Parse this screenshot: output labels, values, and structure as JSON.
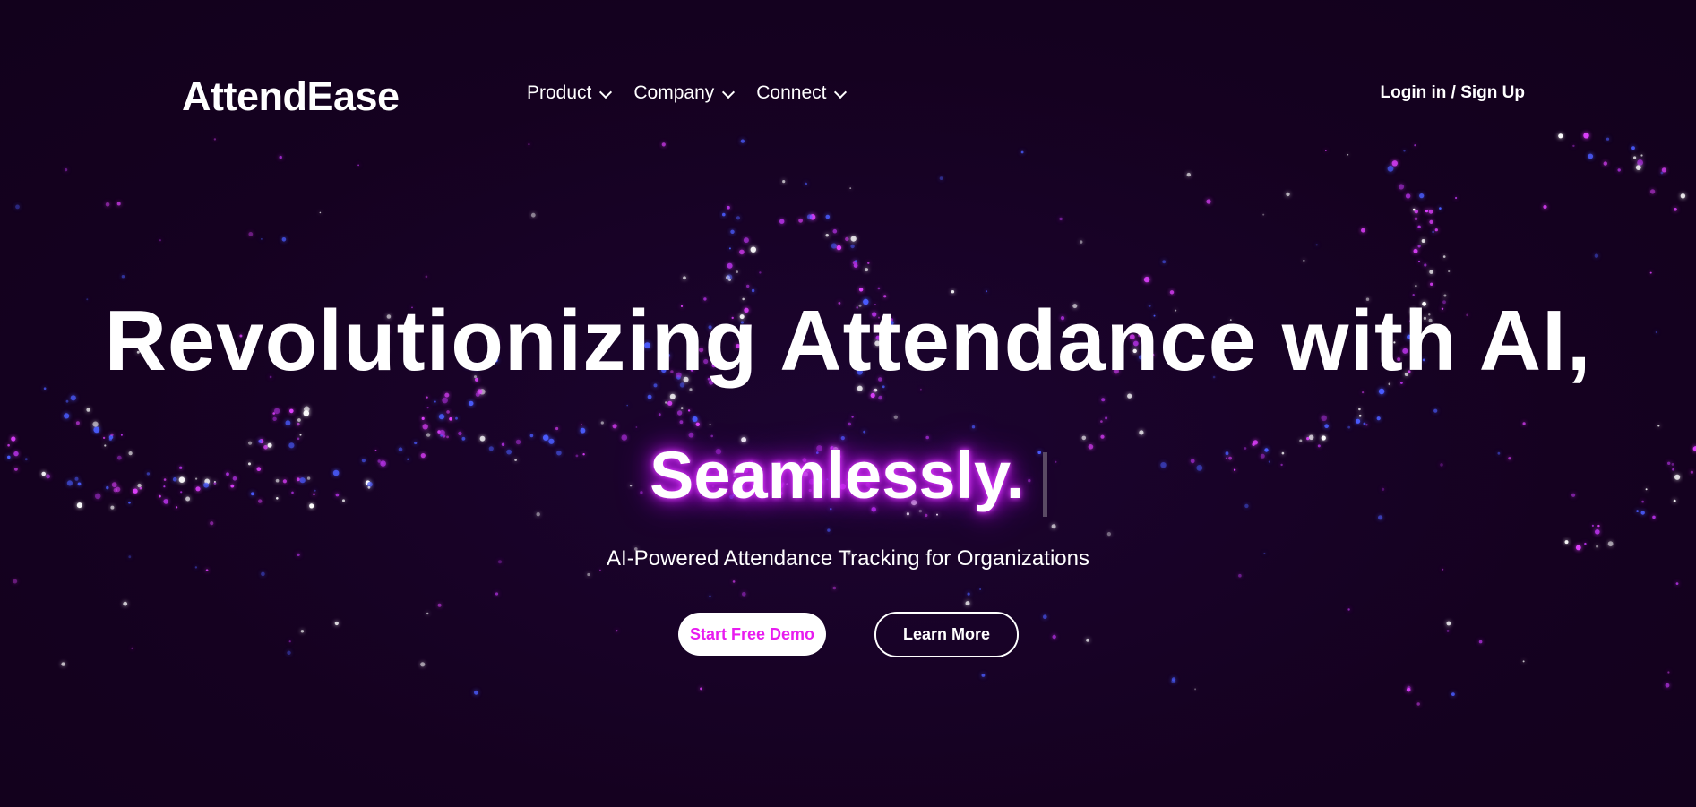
{
  "nav": {
    "brand": "AttendEase",
    "items": [
      {
        "label": "Product"
      },
      {
        "label": "Company"
      },
      {
        "label": "Connect"
      }
    ],
    "login_label": "Login in / Sign Up"
  },
  "hero": {
    "title": "Revolutionizing Attendance with AI,",
    "typed_word": "Seamlessly.",
    "subtitle": "AI-Powered Attendance Tracking for Organizations",
    "primary_button": "Start Free Demo",
    "secondary_button": "Learn More"
  },
  "theme": {
    "background": "#150120",
    "accent": "#e81cf0",
    "glow": "#c024e8",
    "particle_colors": [
      "#e040ff",
      "#ffffff",
      "#4a5cff",
      "#b030e0"
    ]
  }
}
